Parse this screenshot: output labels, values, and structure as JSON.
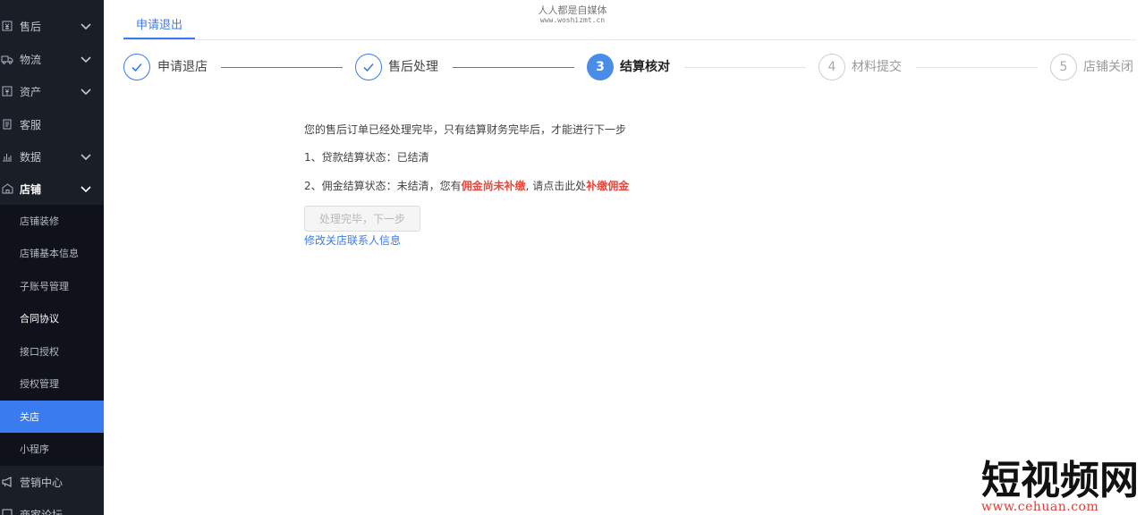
{
  "sidebar": {
    "items": [
      {
        "label": "售后",
        "icon": "yen-receipt-icon"
      },
      {
        "label": "物流",
        "icon": "truck-icon"
      },
      {
        "label": "资产",
        "icon": "yen-box-icon"
      },
      {
        "label": "客服",
        "icon": "document-icon"
      },
      {
        "label": "数据",
        "icon": "bar-chart-icon"
      },
      {
        "label": "店铺",
        "icon": "store-icon"
      }
    ],
    "sub_items": [
      {
        "label": "店铺装修"
      },
      {
        "label": "店铺基本信息"
      },
      {
        "label": "子账号管理"
      },
      {
        "label": "合同协议"
      },
      {
        "label": "接口授权"
      },
      {
        "label": "授权管理"
      },
      {
        "label": "关店"
      },
      {
        "label": "小程序"
      }
    ],
    "bottom_items": [
      {
        "label": "营销中心",
        "icon": "megaphone-icon"
      },
      {
        "label": "商家论坛",
        "icon": "forum-icon"
      }
    ]
  },
  "watermark": {
    "top_line1": "人人都是自媒体",
    "top_line2": "www.woshizmt.cn",
    "corner_big": "短视频网",
    "corner_url": "www.cehuan.com"
  },
  "tab": {
    "label": "申请退出"
  },
  "steps": [
    {
      "number": "1",
      "label": "申请退店",
      "status": "done"
    },
    {
      "number": "2",
      "label": "售后处理",
      "status": "done"
    },
    {
      "number": "3",
      "label": "结算核对",
      "status": "current"
    },
    {
      "number": "4",
      "label": "材料提交",
      "status": "wait"
    },
    {
      "number": "5",
      "label": "店铺关闭",
      "status": "wait"
    }
  ],
  "content": {
    "intro": "您的售后订单已经处理完毕，只有结算财务完毕后，才能进行下一步",
    "line1": "1、贷款结算状态：已结清",
    "line2_prefix": "2、佣金结算状态：未结清，您有",
    "line2_red1": "佣金尚未补缴",
    "line2_mid": ", 请点击此处",
    "line2_red2": "补缴佣金",
    "next_button": "处理完毕，下一步",
    "edit_link": "修改关店联系人信息"
  },
  "colors": {
    "primary": "#3a7bf0",
    "sidebar_bg": "#1a1e27",
    "submenu_bg": "#0f121a",
    "warning_red": "#e5483d"
  }
}
